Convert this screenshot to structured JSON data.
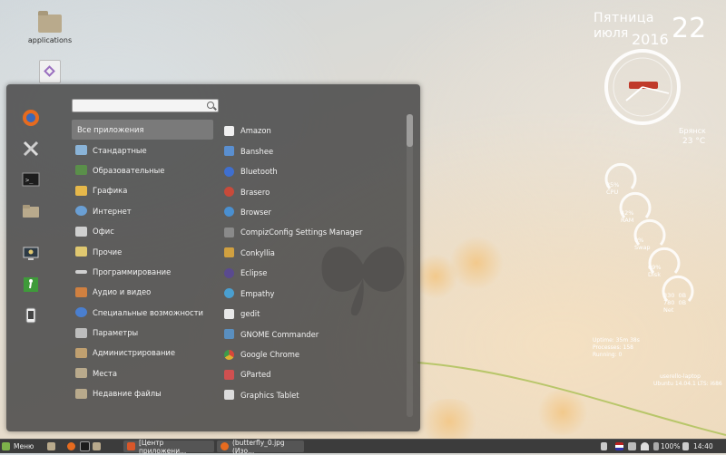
{
  "desktop": {
    "icons": [
      {
        "label": "applications"
      },
      {
        "label": ""
      }
    ]
  },
  "menu": {
    "search": {
      "value": "",
      "placeholder": ""
    },
    "favorites": [
      "firefox-icon",
      "tools-icon",
      "terminal-icon",
      "folder-icon",
      "screen-icon",
      "exit-icon",
      "phone-icon"
    ],
    "categories": [
      {
        "label": "Все приложения",
        "selected": true,
        "color": ""
      },
      {
        "label": "Стандартные",
        "color": "#8ab4d8"
      },
      {
        "label": "Образовательные",
        "color": "#5a8f4a"
      },
      {
        "label": "Графика",
        "color": "#e6b84a"
      },
      {
        "label": "Интернет",
        "color": "#6a9fd4"
      },
      {
        "label": "Офис",
        "color": "#cfcfcf"
      },
      {
        "label": "Прочие",
        "color": "#e0c870"
      },
      {
        "label": "Программирование",
        "color": "#d0d0d0"
      },
      {
        "label": "Аудио и видео",
        "color": "#d08040"
      },
      {
        "label": "Специальные возможности",
        "color": "#4a7fd0"
      },
      {
        "label": "Параметры",
        "color": "#bdbdbd"
      },
      {
        "label": "Администрирование",
        "color": "#c0a070"
      },
      {
        "label": "Места",
        "color": "#b9aa8c"
      },
      {
        "label": "Недавние файлы",
        "color": "#b9aa8c"
      }
    ],
    "apps": [
      {
        "label": "Amazon",
        "color": "#f0f0f0"
      },
      {
        "label": "Banshee",
        "color": "#5a8fd0"
      },
      {
        "label": "Bluetooth",
        "color": "#3f6fcf"
      },
      {
        "label": "Brasero",
        "color": "#c84a3a"
      },
      {
        "label": "Browser",
        "color": "#4a8fd0"
      },
      {
        "label": "CompizConfig Settings Manager",
        "color": "#8a8a8a"
      },
      {
        "label": "Conkyllia",
        "color": "#d0a040"
      },
      {
        "label": "Eclipse",
        "color": "#5a4a8f"
      },
      {
        "label": "Empathy",
        "color": "#4a9fd0"
      },
      {
        "label": "gedit",
        "color": "#e8e8e8"
      },
      {
        "label": "GNOME Commander",
        "color": "#5a8fc0"
      },
      {
        "label": "Google Chrome",
        "color": "#e0b030"
      },
      {
        "label": "GParted",
        "color": "#d05050"
      },
      {
        "label": "Graphics Tablet",
        "color": "#dcdcdc"
      }
    ]
  },
  "clock": {
    "day_name": "Пятница",
    "month": "июля",
    "year": "2016",
    "date": "22",
    "city": "Брянск",
    "temp": "23 °C"
  },
  "stats": {
    "cpu": "35%\nCPU",
    "ram": "42%\nRAM",
    "swap": "0%\nSwap",
    "disk": "69%\nDisk",
    "net": "330  0B\n780  0B\nNet"
  },
  "info": {
    "uptime": "Uptime: 35m 38s",
    "processes": "Processes: 158",
    "running": "Running: 0",
    "host": "userello-laptop",
    "os": "Ubuntu 14.04.1 LTS: i686"
  },
  "taskbar": {
    "menu_label": "Меню",
    "windows": [
      {
        "label": "[Центр приложени..."
      },
      {
        "label": "(butterfly_0.jpg (Изо..."
      }
    ],
    "battery": "100%",
    "time": "14:40"
  }
}
